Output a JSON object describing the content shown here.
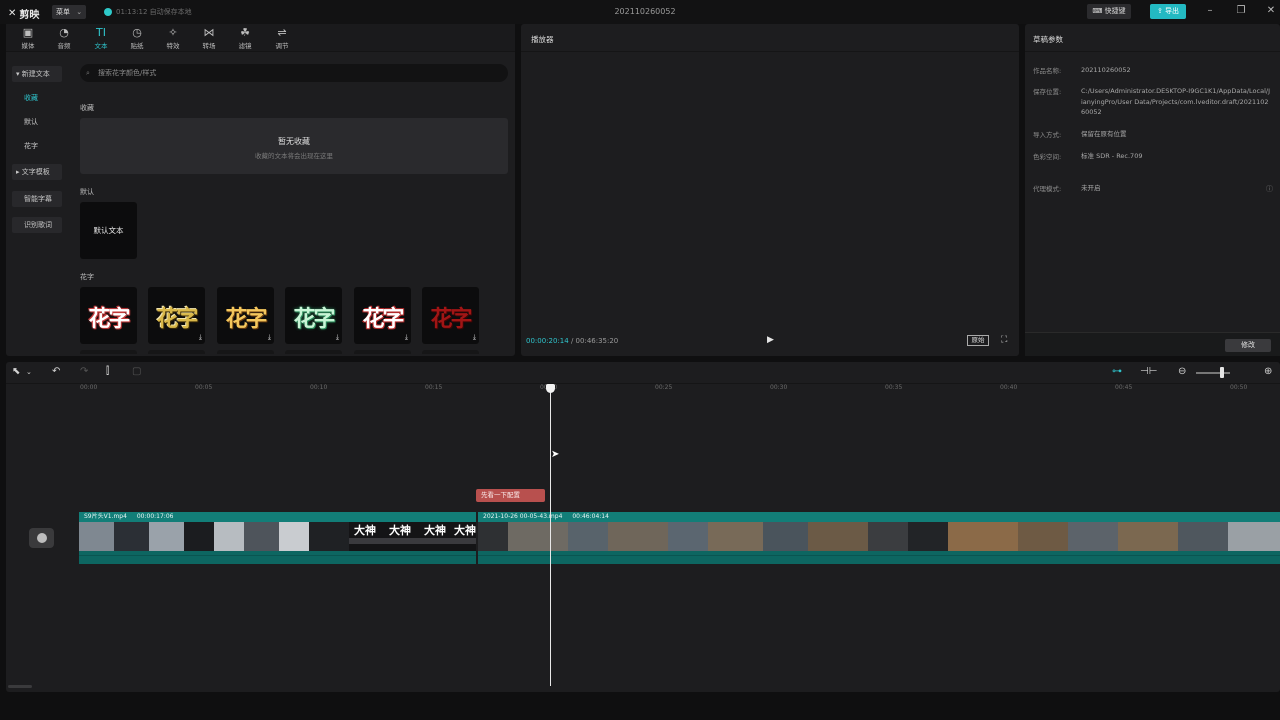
{
  "app": {
    "name": "剪映",
    "menu_label": "菜单",
    "autosave": "01:13:12 自动保存本地",
    "project_title": "202110260052",
    "shortcut_label": "快捷键",
    "export_label": "导出"
  },
  "tool_tabs": [
    {
      "label": "媒体",
      "icon": "media-icon"
    },
    {
      "label": "音频",
      "icon": "audio-icon"
    },
    {
      "label": "文本",
      "icon": "text-icon",
      "active": true
    },
    {
      "label": "贴纸",
      "icon": "sticker-icon"
    },
    {
      "label": "特效",
      "icon": "effects-icon"
    },
    {
      "label": "转场",
      "icon": "transition-icon"
    },
    {
      "label": "滤镜",
      "icon": "filter-icon"
    },
    {
      "label": "调节",
      "icon": "adjust-icon"
    }
  ],
  "side_nav": {
    "new_text": "新建文本",
    "favorites": "收藏",
    "default": "默认",
    "fancy": "花字",
    "templates": "文字模板",
    "smart_subtitles": "智能字幕",
    "lyrics": "识别歌词"
  },
  "text_panel": {
    "search_placeholder": "搜索花字颜色/样式",
    "favorites_label": "收藏",
    "empty_title": "暂无收藏",
    "empty_hint": "收藏的文本将会出现在这里",
    "default_label": "默认",
    "default_tile": "默认文本",
    "fancy_label": "花字",
    "fancy_tiles": [
      {
        "text": "花字",
        "color": "#ffffff",
        "stroke": "#c23a3a",
        "download": false
      },
      {
        "text": "花字",
        "color": "#d9b84a",
        "stroke": "#3b2a05",
        "download": true
      },
      {
        "text": "花字",
        "color": "#f4c75d",
        "stroke": "#6b3c0c",
        "download": true
      },
      {
        "text": "花字",
        "color": "#c8f5d6",
        "stroke": "#2a8a5a",
        "download": true
      },
      {
        "text": "花字",
        "color": "#ffffff",
        "stroke": "#b22a2a",
        "download": true
      },
      {
        "text": "花字",
        "color": "#a11515",
        "stroke": "#3a0505",
        "download": true
      }
    ]
  },
  "player": {
    "title": "播放器",
    "current_time": "00:00:20:14",
    "total_time": "00:46:35:20",
    "original_label": "原始"
  },
  "draft": {
    "title": "草稿参数",
    "rows": [
      {
        "key": "作品名称:",
        "value": "202110260052"
      },
      {
        "key": "保存位置:",
        "value": "C:/Users/Administrator.DESKTOP-I9GC1K1/AppData/Local/JianyingPro/User Data/Projects/com.lveditor.draft/202110260052"
      },
      {
        "key": "导入方式:",
        "value": "保留在原有位置"
      },
      {
        "key": "色彩空间:",
        "value": "标准 SDR - Rec.709"
      },
      {
        "key": "代理模式:",
        "value": "未开启"
      }
    ],
    "edit_label": "修改"
  },
  "timeline": {
    "ticks": [
      "00:00",
      "00:05",
      "00:10",
      "00:15",
      "00:20",
      "00:25",
      "00:30",
      "00:35",
      "00:40",
      "00:45",
      "00:50"
    ],
    "marker_label": "先看一下配置",
    "clip_a": {
      "name": "S9片头V1.mp4",
      "duration": "00:00:17:06"
    },
    "clip_b": {
      "name": "2021-10-26 00-05-43.mp4",
      "duration": "00:46:04:14"
    }
  },
  "colors": {
    "accent": "#2fc4cc",
    "clip": "#0e6f6a",
    "marker": "#b8504e"
  }
}
